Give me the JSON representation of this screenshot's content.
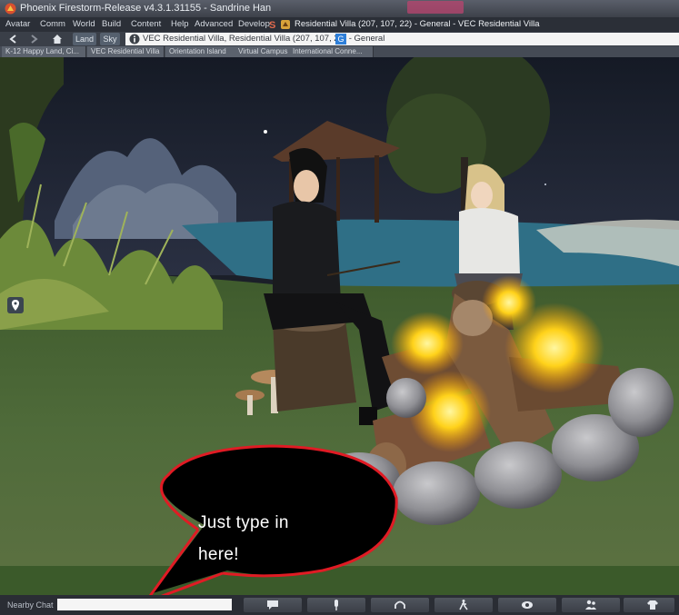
{
  "window": {
    "title": "Phoenix Firestorm-Release v4.3.1.31155 - Sandrine Han"
  },
  "menu": {
    "items": [
      "Avatar",
      "Comm",
      "World",
      "Build",
      "Content",
      "Help",
      "Advanced",
      "Develop"
    ],
    "parcel_text": "Residential Villa (207, 107, 22) - General - VEC Residential Villa"
  },
  "nav": {
    "land_label": "Land",
    "sky_label": "Sky",
    "location": "VEC Residential Villa, Residential Villa (207, 107, 22) - General",
    "location_badge": "G"
  },
  "favorites": [
    "K-12 Happy Land, Ci...",
    "VEC Residential Villa",
    "Orientation Island",
    "Virtual Campus",
    "International Conne..."
  ],
  "callout": {
    "line1": "Just type in",
    "line2": "here!"
  },
  "bottom": {
    "nearby_label": "Nearby Chat",
    "chat_value": "",
    "tools": [
      "chat-icon",
      "microphone-icon",
      "headphones-icon",
      "walk-icon",
      "eye-icon",
      "people-icon",
      "outfit-icon"
    ]
  }
}
